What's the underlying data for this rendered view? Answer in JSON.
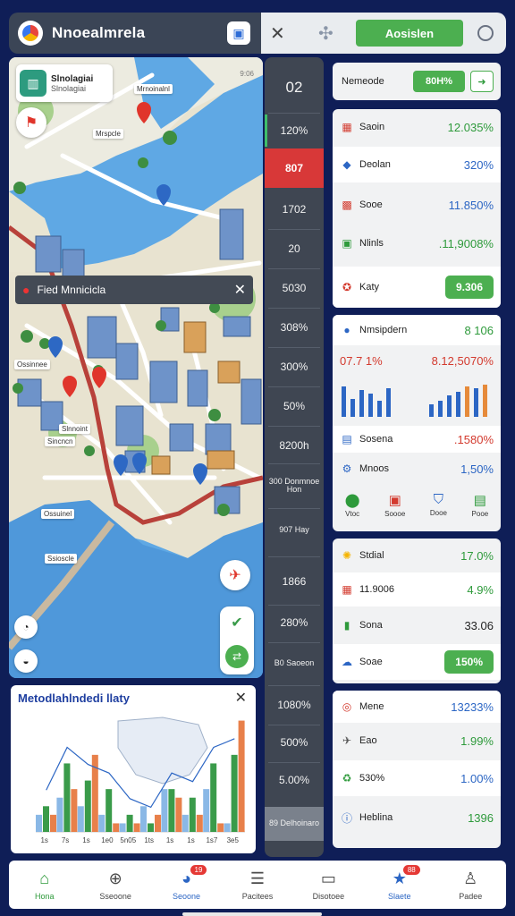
{
  "topbar": {
    "title": "Nnoealmrela",
    "action_label": "Aosislen"
  },
  "map": {
    "card_title": "Slnolagiai",
    "card_subtitle": "Slnolagiai",
    "corner_text": "9:06",
    "popup_label": "Fied Mnnicicla",
    "tags": [
      "Mrnoinalnl",
      "Mrspcle",
      "Ossinnee",
      "Slnnoint",
      "Sincncn",
      "Ossuinel",
      "Ssioscle"
    ]
  },
  "chart": {
    "title": "Metodlahlndedi llaty",
    "ticks": [
      "1s",
      "7s",
      "1s",
      "1e0",
      "5n05",
      "1ts",
      "1s",
      "1s",
      "1s7",
      "3e5"
    ],
    "chart_data": {
      "type": "bar",
      "title": "Metodlahlndedi llaty",
      "categories": [
        "1s",
        "7s",
        "1s",
        "1e0",
        "5n05",
        "1ts",
        "1s",
        "1s",
        "1s7",
        "3e5"
      ],
      "series": [
        {
          "values": [
            2,
            4,
            3,
            2,
            1,
            3,
            5,
            2,
            5,
            1
          ]
        },
        {
          "values": [
            3,
            8,
            6,
            5,
            2,
            1,
            5,
            4,
            8,
            9
          ]
        },
        {
          "values": [
            2,
            5,
            9,
            1,
            1,
            2,
            4,
            2,
            1,
            13
          ]
        }
      ],
      "ylim": [
        0,
        14
      ]
    }
  },
  "midcol": {
    "items": [
      "02",
      "120%",
      "807",
      "1702",
      "20",
      "5030",
      "308%",
      "300%",
      "50%",
      "8200h",
      "300 Donmnoe Hon",
      "907 Hay",
      "1866",
      "280%",
      "B0 Saoeon",
      "1080%",
      "500%",
      "5.00%",
      "89 Delhoinaro"
    ]
  },
  "right": {
    "header_label": "Nemeode",
    "header_button": "80H%",
    "card1": [
      {
        "label": "Saoin",
        "value": "12.035%"
      },
      {
        "label": "Deolan",
        "value": "320%"
      },
      {
        "label": "Sooe",
        "value": "11.850%"
      },
      {
        "label": "Nlinls",
        "value": ".11,9008%"
      },
      {
        "label": "Katy",
        "value": "9.306"
      }
    ],
    "card2_header": {
      "label": "Nmsipdern",
      "value": "8 106"
    },
    "card2_stats": {
      "left": "07.7 1%",
      "right": "8.12,5070%"
    },
    "card2_rows": [
      {
        "label": "Sosena",
        "value": ".1580%"
      },
      {
        "label": "Mnoos",
        "value": "1,50%"
      }
    ],
    "card2_icons": [
      "Vtoc",
      "Soooe",
      "Dooe",
      "Pooe"
    ],
    "card3": [
      {
        "label": "Stdial",
        "value": "17.0%"
      },
      {
        "label": "11.9006",
        "value": "4.9%"
      },
      {
        "label": "Sona",
        "value": "33.06"
      },
      {
        "label": "Soae",
        "value": "150%"
      }
    ],
    "card4": [
      {
        "label": "Mene",
        "value": "13233%"
      },
      {
        "label": "Eao",
        "value": "1.99%"
      },
      {
        "label": "530%",
        "value": "1.00%"
      },
      {
        "label": "Heblina",
        "value": "1396"
      }
    ]
  },
  "nav": {
    "items": [
      {
        "label": "Hona",
        "badge": ""
      },
      {
        "label": "Sseoone",
        "badge": ""
      },
      {
        "label": "Seoone",
        "badge": "19"
      },
      {
        "label": "Pacitees",
        "badge": ""
      },
      {
        "label": "Disotoee",
        "badge": ""
      },
      {
        "label": "Slaete",
        "badge": "88"
      },
      {
        "label": "Padee",
        "badge": ""
      }
    ]
  }
}
